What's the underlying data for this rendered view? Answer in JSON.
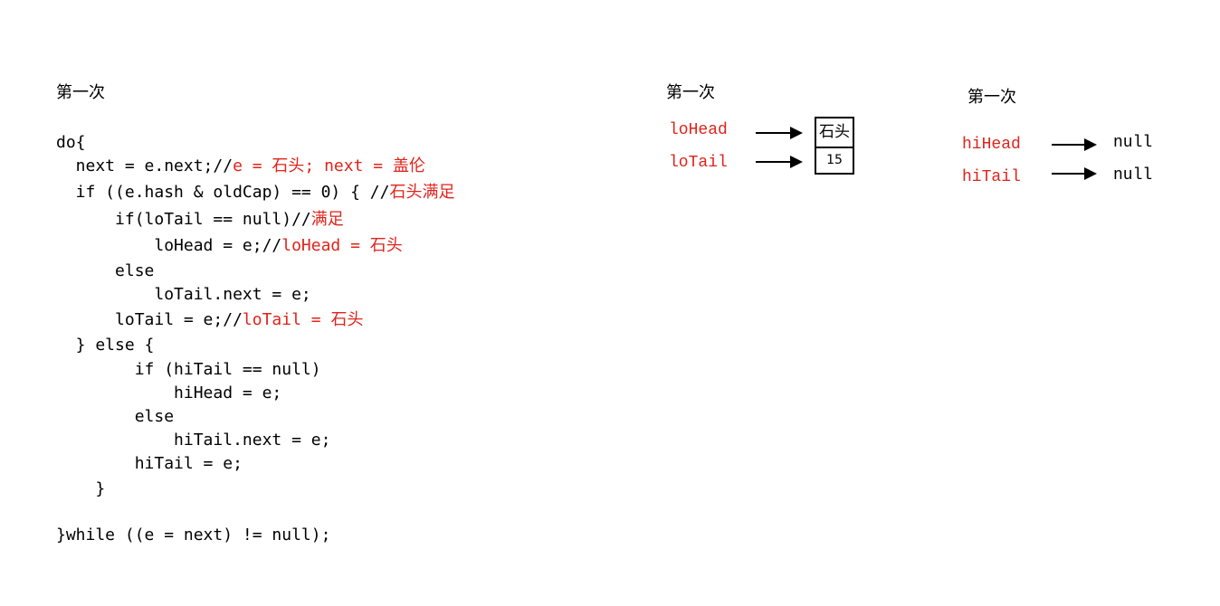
{
  "headings": {
    "code": "第一次",
    "lo": "第一次",
    "hi": "第一次"
  },
  "code": {
    "lines": [
      {
        "text": "do{",
        "comment": ""
      },
      {
        "text": "  next = e.next;//",
        "comment": "e = 石头; next = 盖伦"
      },
      {
        "text": "  if ((e.hash & oldCap) == 0) { //",
        "comment": "石头满足"
      },
      {
        "text": "      if(loTail == null)//",
        "comment": "满足"
      },
      {
        "text": "          loHead = e;//",
        "comment": "loHead = 石头"
      },
      {
        "text": "      else",
        "comment": ""
      },
      {
        "text": "          loTail.next = e;",
        "comment": ""
      },
      {
        "text": "      loTail = e;//",
        "comment": "loTail = 石头"
      },
      {
        "text": "  } else {",
        "comment": ""
      },
      {
        "text": "        if (hiTail == null)",
        "comment": ""
      },
      {
        "text": "            hiHead = e;",
        "comment": ""
      },
      {
        "text": "        else",
        "comment": ""
      },
      {
        "text": "            hiTail.next = e;",
        "comment": ""
      },
      {
        "text": "        hiTail = e;",
        "comment": ""
      },
      {
        "text": "    }",
        "comment": ""
      },
      {
        "text": "",
        "comment": ""
      },
      {
        "text": "}while ((e = next) != null);",
        "comment": ""
      }
    ]
  },
  "lo_diagram": {
    "head_label": "loHead",
    "tail_label": "loTail",
    "node": {
      "key": "石头",
      "value": "15"
    }
  },
  "hi_diagram": {
    "head_label": "hiHead",
    "tail_label": "hiTail",
    "head_target": "null",
    "tail_target": "null"
  },
  "colors": {
    "highlight": "#e0231b",
    "text": "#000000",
    "background": "#ffffff"
  }
}
